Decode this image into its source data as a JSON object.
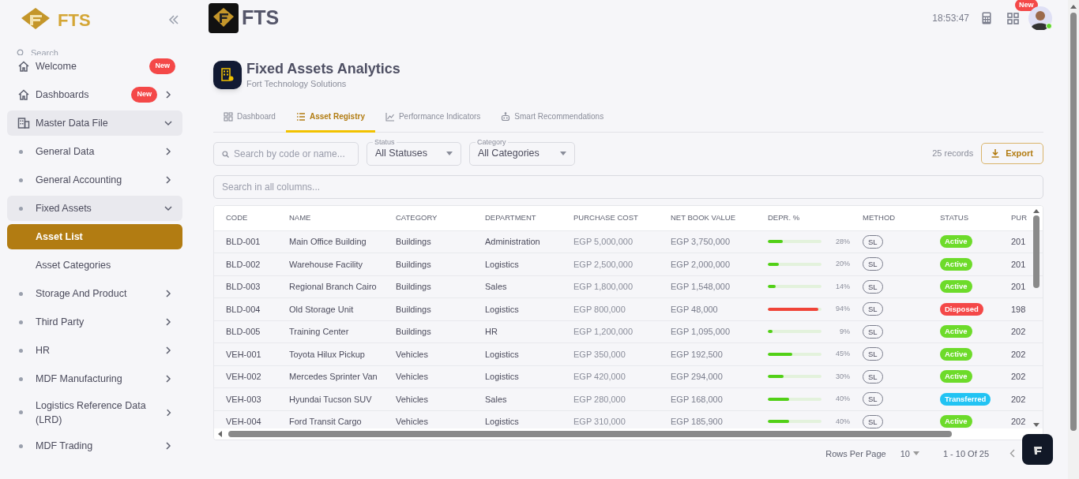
{
  "sidebar": {
    "logo_text": "FTS",
    "search_placeholder": "Search",
    "items": [
      {
        "label": "Welcome",
        "badge": "New",
        "kind": "link",
        "selected": false
      },
      {
        "label": "Dashboards",
        "badge": "New",
        "kind": "group",
        "selected": false,
        "expanded": false
      },
      {
        "label": "Master Data File",
        "kind": "group",
        "selected": false,
        "expanded": true,
        "children": [
          {
            "label": "General Data",
            "kind": "group",
            "expanded": false
          },
          {
            "label": "General Accounting",
            "kind": "group",
            "expanded": false
          },
          {
            "label": "Fixed Assets",
            "kind": "group",
            "expanded": true,
            "children": [
              {
                "label": "Asset List",
                "selected": true
              },
              {
                "label": "Asset Categories",
                "selected": false
              }
            ]
          },
          {
            "label": "Storage And Product",
            "kind": "group",
            "expanded": false
          },
          {
            "label": "Third Party",
            "kind": "group",
            "expanded": false
          },
          {
            "label": "HR",
            "kind": "group",
            "expanded": false
          },
          {
            "label": "MDF Manufacturing",
            "kind": "group",
            "expanded": false
          },
          {
            "label": "Logistics Reference Data (LRD)",
            "kind": "group",
            "expanded": false
          },
          {
            "label": "MDF Trading",
            "kind": "group",
            "expanded": false
          }
        ]
      }
    ]
  },
  "header": {
    "brand": "FTS",
    "time": "18:53:47",
    "apps_badge": "New"
  },
  "page": {
    "title": "Fixed Assets Analytics",
    "subtitle": "Fort Technology Solutions"
  },
  "tabs": [
    {
      "label": "Dashboard",
      "selected": false
    },
    {
      "label": "Asset Registry",
      "selected": true
    },
    {
      "label": "Performance Indicators",
      "selected": false
    },
    {
      "label": "Smart Recommendations",
      "selected": false
    }
  ],
  "filters": {
    "search_placeholder": "Search by code or name...",
    "status": {
      "label": "Status",
      "value": "All Statuses"
    },
    "category": {
      "label": "Category",
      "value": "All Categories"
    },
    "records": "25 records",
    "export": "Export",
    "global_search_placeholder": "Search in all columns..."
  },
  "table": {
    "columns": [
      "CODE",
      "NAME",
      "CATEGORY",
      "DEPARTMENT",
      "PURCHASE COST",
      "NET BOOK VALUE",
      "DEPR. %",
      "METHOD",
      "STATUS",
      "PUR"
    ],
    "rows": [
      {
        "code": "BLD-001",
        "name": "Main Office Building",
        "category": "Buildings",
        "department": "Administration",
        "cost": "EGP 5,000,000",
        "nbv": "EGP 3,750,000",
        "depr": {
          "level": 0.28,
          "label": "28%",
          "color": "#52d017"
        },
        "method": "SL",
        "status": {
          "label": "Active",
          "color": "#6ddb2a"
        },
        "column_10": "201"
      },
      {
        "code": "BLD-002",
        "name": "Warehouse Facility",
        "category": "Buildings",
        "department": "Logistics",
        "cost": "EGP 2,500,000",
        "nbv": "EGP 2,000,000",
        "depr": {
          "level": 0.2,
          "label": "20%",
          "color": "#52d017"
        },
        "method": "SL",
        "status": {
          "label": "Active",
          "color": "#6ddb2a"
        },
        "column_10": "201"
      },
      {
        "code": "BLD-003",
        "name": "Regional Branch Cairo",
        "category": "Buildings",
        "department": "Sales",
        "cost": "EGP 1,800,000",
        "nbv": "EGP 1,548,000",
        "depr": {
          "level": 0.14,
          "label": "14%",
          "color": "#52d017"
        },
        "method": "SL",
        "status": {
          "label": "Active",
          "color": "#6ddb2a"
        },
        "column_10": "201"
      },
      {
        "code": "BLD-004",
        "name": "Old Storage Unit",
        "category": "Buildings",
        "department": "Logistics",
        "cost": "EGP 800,000",
        "nbv": "EGP 48,000",
        "depr": {
          "level": 0.94,
          "label": "94%",
          "color": "#f04438"
        },
        "method": "SL",
        "status": {
          "label": "Disposed",
          "color": "#f44848"
        },
        "column_10": "198"
      },
      {
        "code": "BLD-005",
        "name": "Training Center",
        "category": "Buildings",
        "department": "HR",
        "cost": "EGP 1,200,000",
        "nbv": "EGP 1,095,000",
        "depr": {
          "level": 0.09,
          "label": "9%",
          "color": "#52d017"
        },
        "method": "SL",
        "status": {
          "label": "Active",
          "color": "#6ddb2a"
        },
        "column_10": "202"
      },
      {
        "code": "VEH-001",
        "name": "Toyota Hilux Pickup",
        "category": "Vehicles",
        "department": "Logistics",
        "cost": "EGP 350,000",
        "nbv": "EGP 192,500",
        "depr": {
          "level": 0.45,
          "label": "45%",
          "color": "#52d017"
        },
        "method": "SL",
        "status": {
          "label": "Active",
          "color": "#6ddb2a"
        },
        "column_10": "202"
      },
      {
        "code": "VEH-002",
        "name": "Mercedes Sprinter Van",
        "category": "Vehicles",
        "department": "Logistics",
        "cost": "EGP 420,000",
        "nbv": "EGP 294,000",
        "depr": {
          "level": 0.3,
          "label": "30%",
          "color": "#52d017"
        },
        "method": "SL",
        "status": {
          "label": "Active",
          "color": "#6ddb2a"
        },
        "column_10": "202"
      },
      {
        "code": "VEH-003",
        "name": "Hyundai Tucson SUV",
        "category": "Vehicles",
        "department": "Sales",
        "cost": "EGP 280,000",
        "nbv": "EGP 168,000",
        "depr": {
          "level": 0.4,
          "label": "40%",
          "color": "#52d017"
        },
        "method": "SL",
        "status": {
          "label": "Transferred",
          "color": "#22c3f3"
        },
        "column_10": "202"
      },
      {
        "code": "VEH-004",
        "name": "Ford Transit Cargo",
        "category": "Vehicles",
        "department": "Logistics",
        "cost": "EGP 310,000",
        "nbv": "EGP 185,900",
        "depr": {
          "level": 0.4,
          "label": "40%",
          "color": "#52d017"
        },
        "method": "SL",
        "status": {
          "label": "Active",
          "color": "#6ddb2a"
        },
        "column_10": "202"
      }
    ]
  },
  "pagination": {
    "rows_per_page_label": "Rows Per Page",
    "rows_per_page": "10",
    "range": "1 - 10 Of 25"
  }
}
